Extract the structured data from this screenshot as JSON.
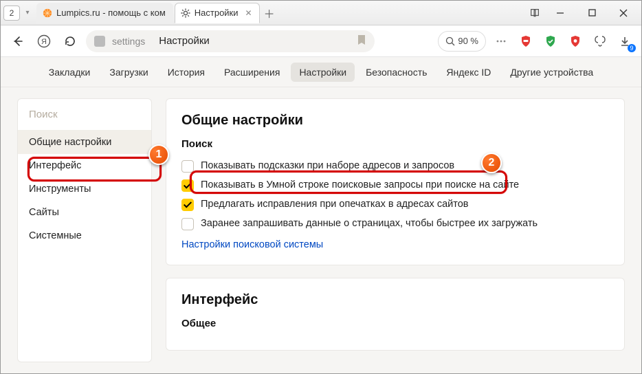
{
  "titlebar": {
    "tab_count": "2",
    "tabs": [
      {
        "label": "Lumpics.ru - помощь с ком",
        "favicon": "orange"
      },
      {
        "label": "Настройки",
        "favicon": "gear"
      }
    ]
  },
  "toolbar": {
    "url_left": "settings",
    "url_title": "Настройки",
    "zoom": "90 %",
    "download_count": "9"
  },
  "settings_nav": {
    "items": [
      "Закладки",
      "Загрузки",
      "История",
      "Расширения",
      "Настройки",
      "Безопасность",
      "Яндекс ID",
      "Другие устройства"
    ],
    "active_index": 4
  },
  "sidebar": {
    "search_placeholder": "Поиск",
    "items": [
      "Общие настройки",
      "Интерфейс",
      "Инструменты",
      "Сайты",
      "Системные"
    ],
    "active_index": 0
  },
  "general": {
    "heading": "Общие настройки",
    "section_search": "Поиск",
    "opts": [
      {
        "label": "Показывать подсказки при наборе адресов и запросов",
        "checked": false
      },
      {
        "label": "Показывать в Умной строке поисковые запросы при поиске на сайте",
        "checked": true
      },
      {
        "label": "Предлагать исправления при опечатках в адресах сайтов",
        "checked": true
      },
      {
        "label": "Заранее запрашивать данные о страницах, чтобы быстрее их загружать",
        "checked": false
      }
    ],
    "search_engine_link": "Настройки поисковой системы"
  },
  "interface": {
    "heading": "Интерфейс",
    "sub": "Общее"
  },
  "annotations": {
    "badge1": "1",
    "badge2": "2"
  }
}
